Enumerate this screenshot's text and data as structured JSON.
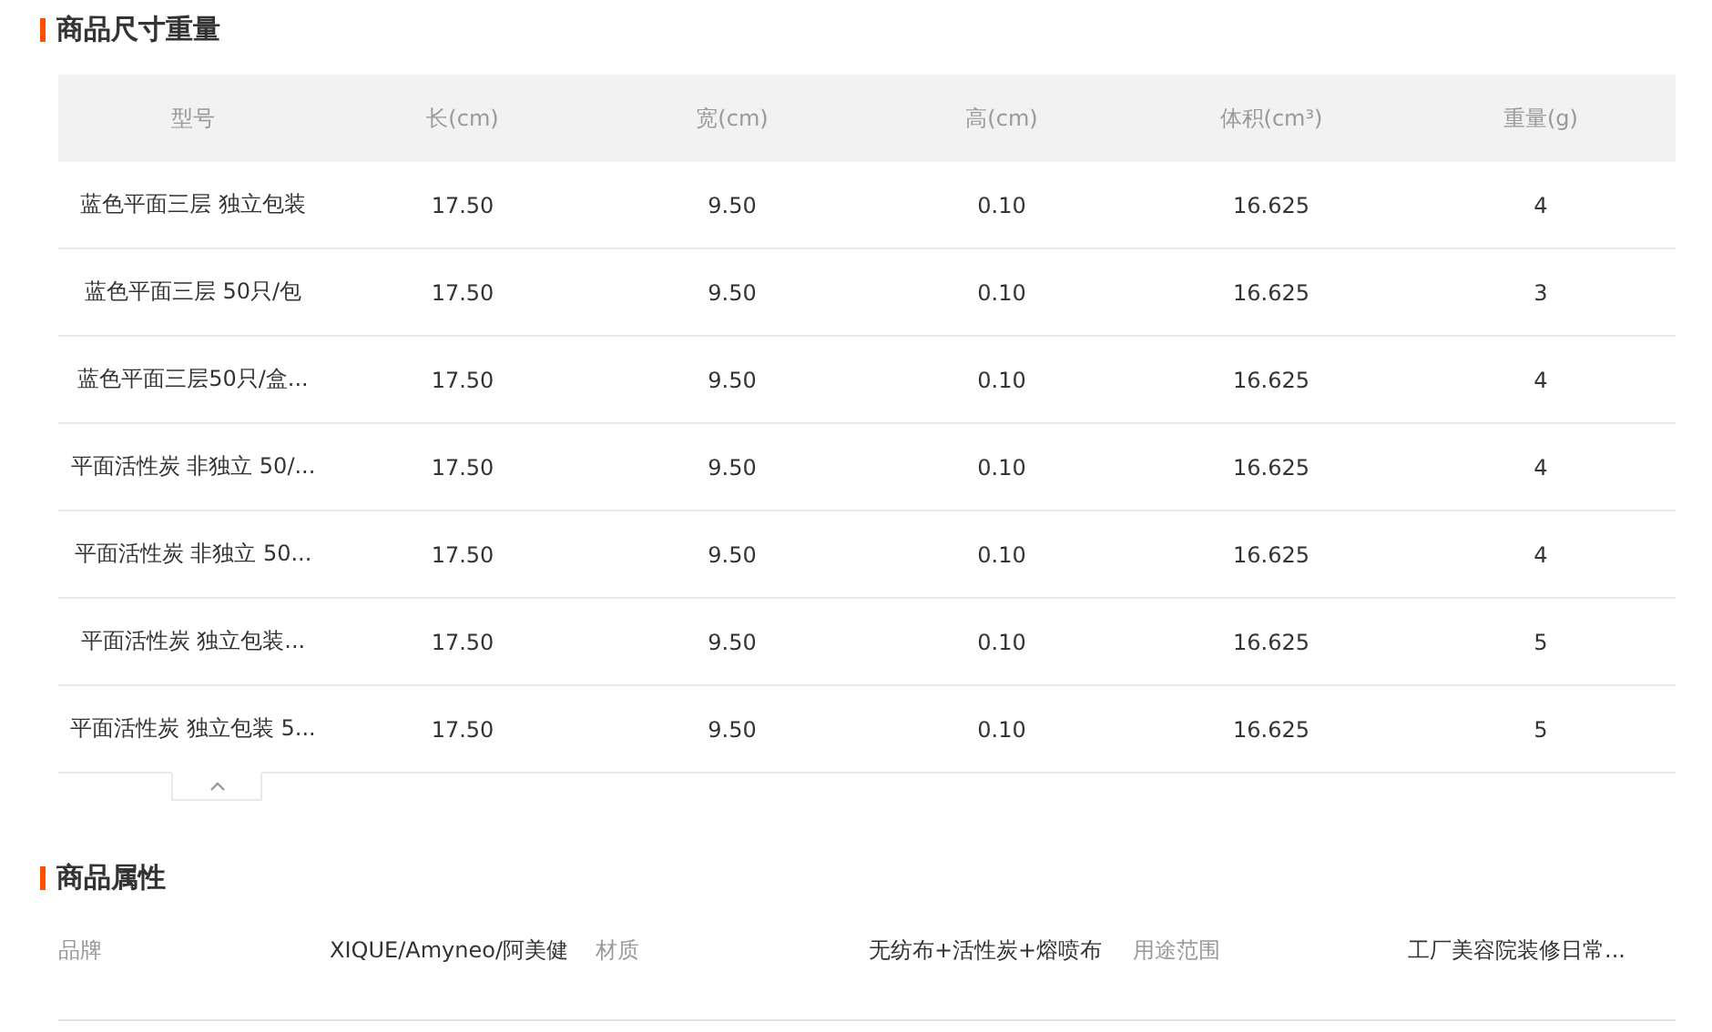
{
  "sections": [
    {
      "title": "商品尺寸重量",
      "kind": "table",
      "table": {
        "columns": [
          "型号",
          "长(cm)",
          "宽(cm)",
          "高(cm)",
          "体积(cm³)",
          "重量(g)"
        ],
        "rows": [
          [
            "蓝色平面三层 独立包装",
            "17.50",
            "9.50",
            "0.10",
            "16.625",
            "4"
          ],
          [
            "蓝色平面三层 50只/包",
            "17.50",
            "9.50",
            "0.10",
            "16.625",
            "3"
          ],
          [
            "蓝色平面三层50只/盒...",
            "17.50",
            "9.50",
            "0.10",
            "16.625",
            "4"
          ],
          [
            "平面活性炭 非独立 50/...",
            "17.50",
            "9.50",
            "0.10",
            "16.625",
            "4"
          ],
          [
            "平面活性炭 非独立 50...",
            "17.50",
            "9.50",
            "0.10",
            "16.625",
            "4"
          ],
          [
            "平面活性炭 独立包装...",
            "17.50",
            "9.50",
            "0.10",
            "16.625",
            "5"
          ],
          [
            "平面活性炭 独立包装 5...",
            "17.50",
            "9.50",
            "0.10",
            "16.625",
            "5"
          ]
        ]
      },
      "collapse_toggle": {
        "expanded": true
      }
    },
    {
      "title": "商品属性",
      "kind": "attributes",
      "attributes": [
        {
          "label": "品牌",
          "value": "XIQUE/Amyneo/阿美健"
        },
        {
          "label": "材质",
          "value": "无纺布+活性炭+熔喷布"
        },
        {
          "label": "用途范围",
          "value": "工厂美容院装修日常..."
        }
      ]
    }
  ]
}
